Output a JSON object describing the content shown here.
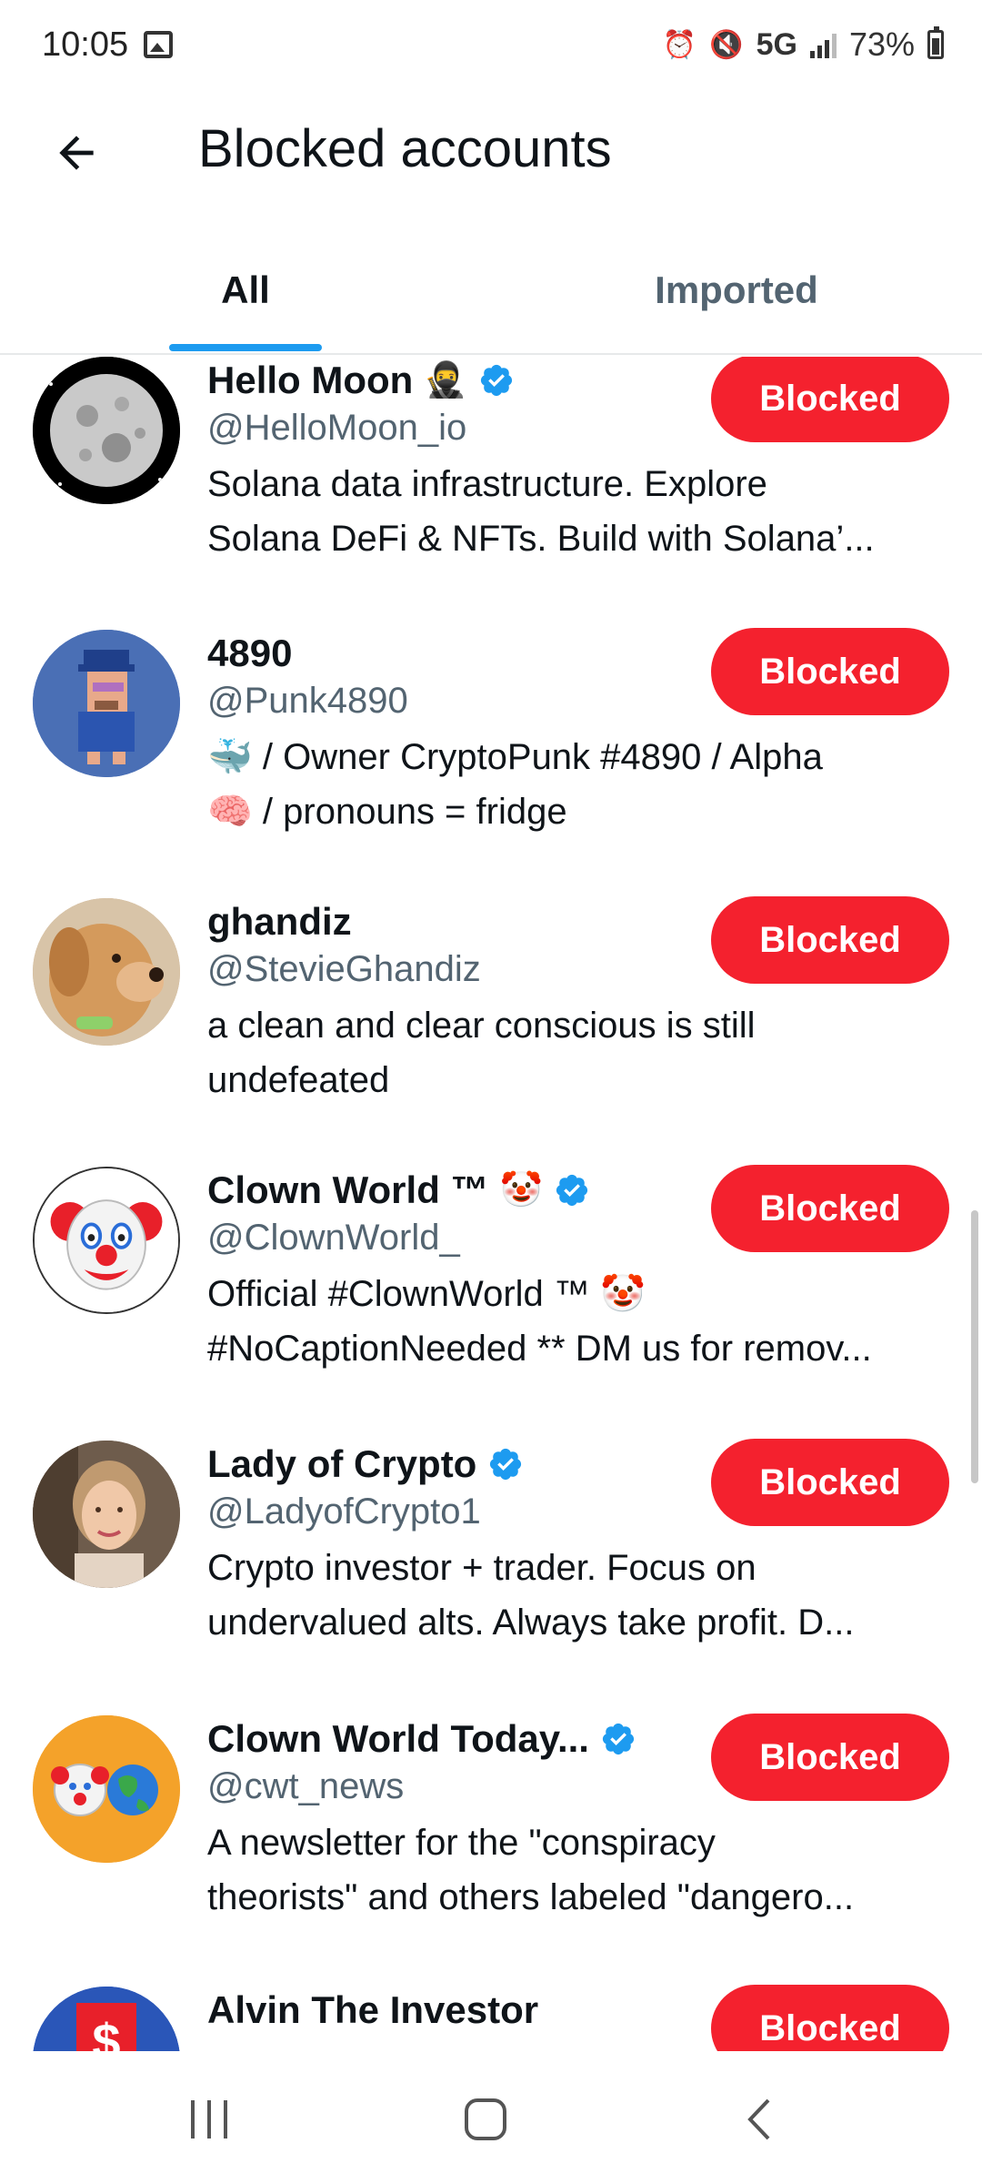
{
  "status_bar": {
    "time": "10:05",
    "network": "5G",
    "battery": "73%"
  },
  "header": {
    "title": "Blocked accounts"
  },
  "tabs": [
    {
      "label": "All",
      "selected": true
    },
    {
      "label": "Imported",
      "selected": false
    }
  ],
  "colors": {
    "accent": "#1d9bf0",
    "blocked": "#f4212e"
  },
  "accounts": [
    {
      "name": "Hello Moon",
      "name_emoji": "🥷",
      "verified": true,
      "handle": "@HelloMoon_io",
      "bio_lines": [
        "Solana data infrastructure. Explore",
        "Solana DeFi & NFTs. Build with Solana’..."
      ],
      "button_label": "Blocked",
      "avatar": "moon-avatar"
    },
    {
      "name": "4890",
      "name_emoji": "",
      "verified": false,
      "handle": "@Punk4890",
      "bio_lines": [
        "🐳 / Owner CryptoPunk #4890 / Alpha",
        "🧠 / pronouns = fridge"
      ],
      "button_label": "Blocked",
      "avatar": "pixel-punk-avatar"
    },
    {
      "name": "ghandiz",
      "name_emoji": "",
      "verified": false,
      "handle": "@StevieGhandiz",
      "bio_lines": [
        "a clean and clear conscious is still",
        "undefeated"
      ],
      "button_label": "Blocked",
      "avatar": "dog-avatar"
    },
    {
      "name": "Clown World ™",
      "name_emoji": "🤡",
      "verified": true,
      "handle": "@ClownWorld_",
      "bio_lines": [
        "Official #ClownWorld ™ 🤡",
        "#NoCaptionNeeded ** DM us for remov..."
      ],
      "button_label": "Blocked",
      "avatar": "clown-avatar"
    },
    {
      "name": "Lady of Crypto",
      "name_emoji": "",
      "verified": true,
      "handle": "@LadyofCrypto1",
      "bio_lines": [
        "Crypto investor + trader. Focus on",
        "undervalued alts. Always take profit. D..."
      ],
      "button_label": "Blocked",
      "avatar": "woman-avatar"
    },
    {
      "name": "Clown World Today...",
      "name_emoji": "",
      "verified": true,
      "handle": "@cwt_news",
      "bio_lines": [
        "A newsletter for the \"conspiracy",
        "theorists\" and others labeled \"dangero..."
      ],
      "button_label": "Blocked",
      "avatar": "clown-globe-avatar"
    },
    {
      "name": "Alvin The Investor",
      "name_emoji": "",
      "verified": false,
      "handle": "",
      "bio_lines": [],
      "button_label": "Blocked",
      "avatar": "dollar-avatar"
    }
  ]
}
